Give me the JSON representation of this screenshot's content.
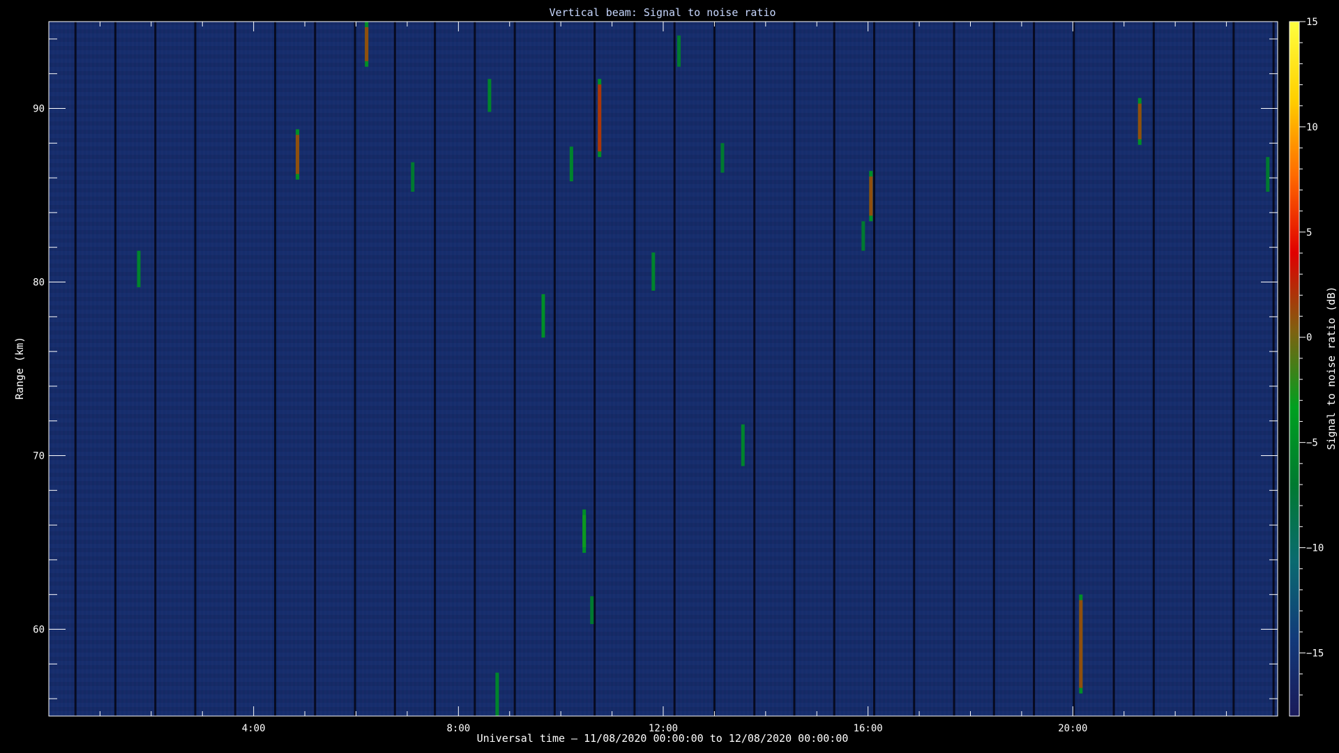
{
  "chart_data": {
    "type": "heatmap",
    "title": "Vertical beam: Signal to noise ratio",
    "xlabel": "Universal time – 11/08/2020 00:00:00 to 12/08/2020 00:00:00",
    "ylabel": "Range (km)",
    "x_unit": "hours UT",
    "xlim": [
      0,
      24
    ],
    "ylim": [
      55,
      95
    ],
    "x_ticks": [
      {
        "value": 4,
        "label": "4:00"
      },
      {
        "value": 8,
        "label": "8:00"
      },
      {
        "value": 12,
        "label": "12:00"
      },
      {
        "value": 16,
        "label": "16:00"
      },
      {
        "value": 20,
        "label": "20:00"
      }
    ],
    "y_ticks": [
      {
        "value": 60,
        "label": "60"
      },
      {
        "value": 70,
        "label": "70"
      },
      {
        "value": 80,
        "label": "80"
      },
      {
        "value": 90,
        "label": "90"
      }
    ],
    "colorbar": {
      "label": "Signal to noise ratio (dB)",
      "range": [
        -18,
        15
      ],
      "ticks": [
        {
          "value": 15,
          "label": "15"
        },
        {
          "value": 10,
          "label": "10"
        },
        {
          "value": 5,
          "label": "5"
        },
        {
          "value": 0,
          "label": "0"
        },
        {
          "value": -5,
          "label": "−5"
        },
        {
          "value": -10,
          "label": "−10"
        },
        {
          "value": -15,
          "label": "−15"
        }
      ],
      "colors": [
        "#1a1a5a",
        "#123a7a",
        "#0a6a70",
        "#007a30",
        "#00a020",
        "#806010",
        "#e00000",
        "#ff6a00",
        "#ffd000",
        "#ffff40"
      ]
    },
    "background_snr": -16,
    "features": [
      {
        "t": 1.75,
        "r0": 79.7,
        "r1": 81.8,
        "snr": -6
      },
      {
        "t": 4.85,
        "r0": 85.9,
        "r1": 88.8,
        "snr": 1
      },
      {
        "t": 6.2,
        "r0": 92.4,
        "r1": 95,
        "snr": 1
      },
      {
        "t": 7.1,
        "r0": 85.2,
        "r1": 86.9,
        "snr": -7
      },
      {
        "t": 8.6,
        "r0": 89.8,
        "r1": 91.7,
        "snr": -6
      },
      {
        "t": 8.75,
        "r0": 55,
        "r1": 57.5,
        "snr": -6
      },
      {
        "t": 9.65,
        "r0": 76.8,
        "r1": 79.3,
        "snr": -5
      },
      {
        "t": 10.2,
        "r0": 85.8,
        "r1": 87.8,
        "snr": -6
      },
      {
        "t": 10.45,
        "r0": 64.4,
        "r1": 66.9,
        "snr": -3
      },
      {
        "t": 10.6,
        "r0": 60.3,
        "r1": 61.9,
        "snr": -7
      },
      {
        "t": 10.75,
        "r0": 87.2,
        "r1": 91.7,
        "snr": 2
      },
      {
        "t": 11.8,
        "r0": 79.5,
        "r1": 81.7,
        "snr": -6
      },
      {
        "t": 12.3,
        "r0": 92.4,
        "r1": 94.2,
        "snr": -7
      },
      {
        "t": 13.15,
        "r0": 86.3,
        "r1": 88,
        "snr": -7
      },
      {
        "t": 13.55,
        "r0": 69.4,
        "r1": 71.8,
        "snr": -6
      },
      {
        "t": 15.9,
        "r0": 81.8,
        "r1": 83.5,
        "snr": -7
      },
      {
        "t": 16.05,
        "r0": 83.5,
        "r1": 86.4,
        "snr": 1
      },
      {
        "t": 20.15,
        "r0": 56.3,
        "r1": 62,
        "snr": 1
      },
      {
        "t": 21.3,
        "r0": 87.9,
        "r1": 90.6,
        "snr": 1
      },
      {
        "t": 23.8,
        "r0": 85.2,
        "r1": 87.2,
        "snr": -7
      }
    ],
    "grid": false,
    "legend": "colorbar-right"
  }
}
